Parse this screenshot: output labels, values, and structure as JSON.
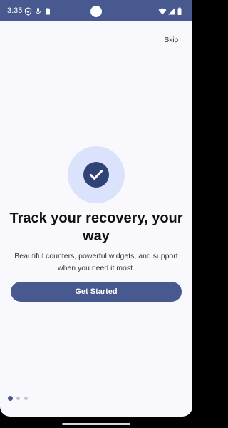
{
  "status_bar": {
    "time": "3:35",
    "left_icons": [
      "shield-icon",
      "mic-icon",
      "sim-card-icon"
    ],
    "right_icons": [
      "wifi-icon",
      "cellular-signal-icon",
      "battery-icon"
    ]
  },
  "onboarding": {
    "skip_label": "Skip",
    "hero_icon": "check-circle-icon",
    "title": "Track your recovery, your way",
    "subtitle": "Beautiful counters, powerful widgets, and support when you need it most.",
    "cta_label": "Get Started",
    "page_indicator": {
      "total_pages": 3,
      "current_page": 1
    }
  },
  "colors": {
    "primary": "#47598e",
    "hero_circle": "#dbe2fb",
    "check_fill": "#2f4377",
    "background": "#f9f8fd"
  }
}
